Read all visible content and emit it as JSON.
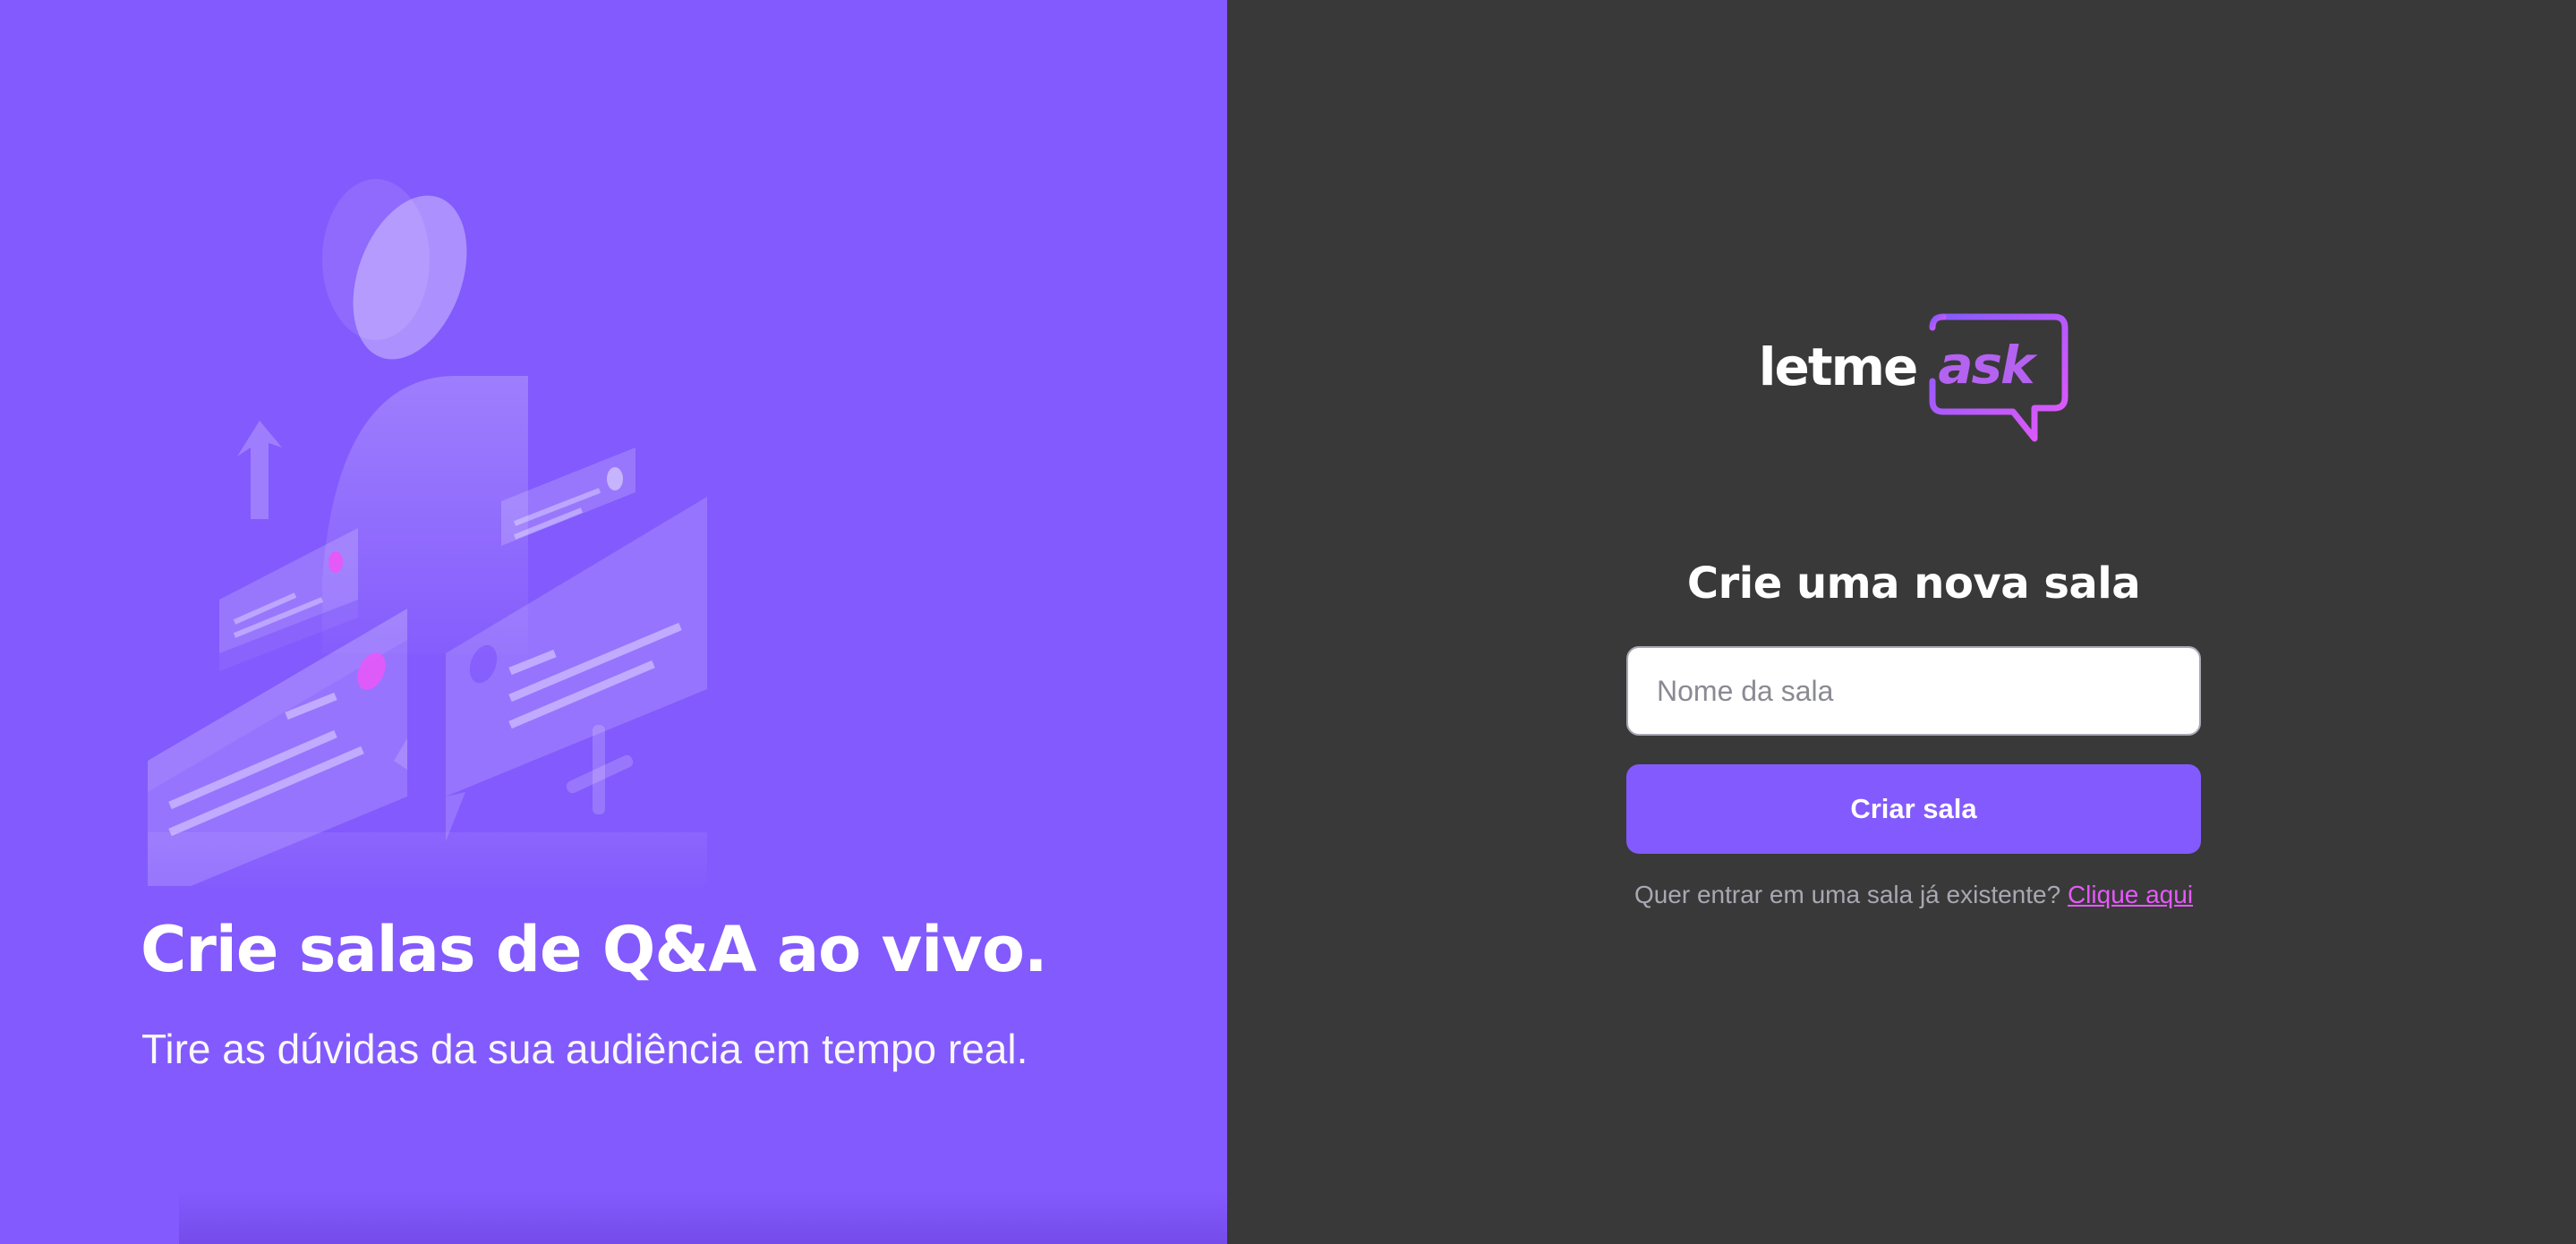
{
  "aside": {
    "illustration_icon": "questions-illustration",
    "title": "Crie salas de Q&A ao vivo.",
    "subtitle": "Tire as dúvidas da sua audiência em tempo real."
  },
  "logo": {
    "text_left": "letme",
    "text_right": "ask"
  },
  "form": {
    "title": "Crie uma nova sala",
    "room_name_placeholder": "Nome da sala",
    "room_name_value": "",
    "submit_label": "Criar sala"
  },
  "join": {
    "prompt": "Quer entrar em uma sala já existente?",
    "link_label": "Clique aqui"
  },
  "colors": {
    "purple": "#835afd",
    "dark_bg": "#393939",
    "pink": "#e559f9",
    "gray_text": "#a8a8b3"
  }
}
